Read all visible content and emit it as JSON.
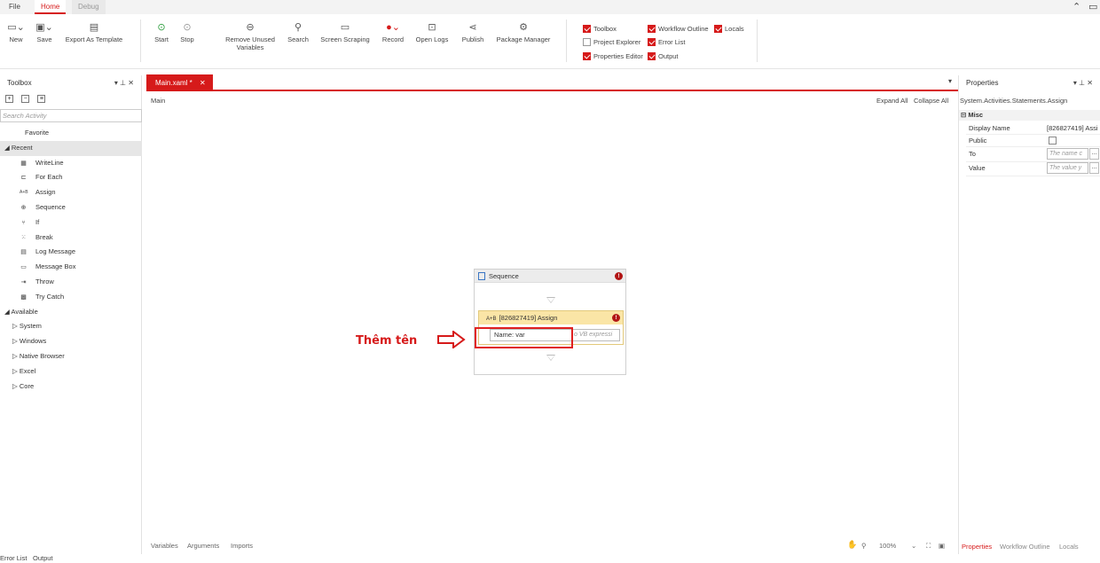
{
  "menu": {
    "file": "File",
    "home": "Home",
    "debug": "Debug"
  },
  "ribbon": {
    "new": "New",
    "save": "Save",
    "export_template": "Export As Template",
    "start": "Start",
    "stop": "Stop",
    "remove_unused_1": "Remove Unused",
    "remove_unused_2": "Variables",
    "search": "Search",
    "screen_scraping": "Screen Scraping",
    "record": "Record",
    "open_logs": "Open Logs",
    "publish": "Publish",
    "package_manager": "Package Manager",
    "panels": {
      "toolbox": "Toolbox",
      "workflow_outline": "Workflow Outline",
      "locals": "Locals",
      "project_explorer": "Project Explorer",
      "error_list": "Error List",
      "properties_editor": "Properties Editor",
      "output": "Output"
    }
  },
  "toolbox": {
    "title": "Toolbox",
    "search_placeholder": "Search Activity",
    "favorite": "Favorite",
    "recent": "Recent",
    "items": [
      "WriteLine",
      "For Each",
      "Assign",
      "Sequence",
      "If",
      "Break",
      "Log Message",
      "Message Box",
      "Throw",
      "Try Catch"
    ],
    "available": "Available",
    "categories": [
      "System",
      "Windows",
      "Native Browser",
      "Excel",
      "Core"
    ]
  },
  "designer": {
    "tab": "Main.xaml *",
    "breadcrumb": "Main",
    "expand_all": "Expand All",
    "collapse_all": "Collapse All",
    "sequence_title": "Sequence",
    "assign_title": "[826827419] Assign",
    "name_label": "Name:",
    "name_value": "var",
    "vb_placeholder": "o VB expressi",
    "annotation": "Thêm tên",
    "bottom": {
      "variables": "Variables",
      "arguments": "Arguments",
      "imports": "Imports",
      "zoom": "100%"
    }
  },
  "properties": {
    "title": "Properties",
    "path": "System.Activities.Statements.Assign",
    "category": "Misc",
    "display_name_label": "Display Name",
    "display_name_value": "[826827419] Assi",
    "public_label": "Public",
    "to_label": "To",
    "to_placeholder": "The name c",
    "value_label": "Value",
    "value_placeholder": "The value y",
    "tabs": {
      "properties": "Properties",
      "workflow_outline": "Workflow Outline",
      "locals": "Locals"
    }
  },
  "status": {
    "error_list": "Error List",
    "output": "Output"
  },
  "colors": {
    "accent": "#d61a1a",
    "assign_header": "#fae5a6"
  }
}
